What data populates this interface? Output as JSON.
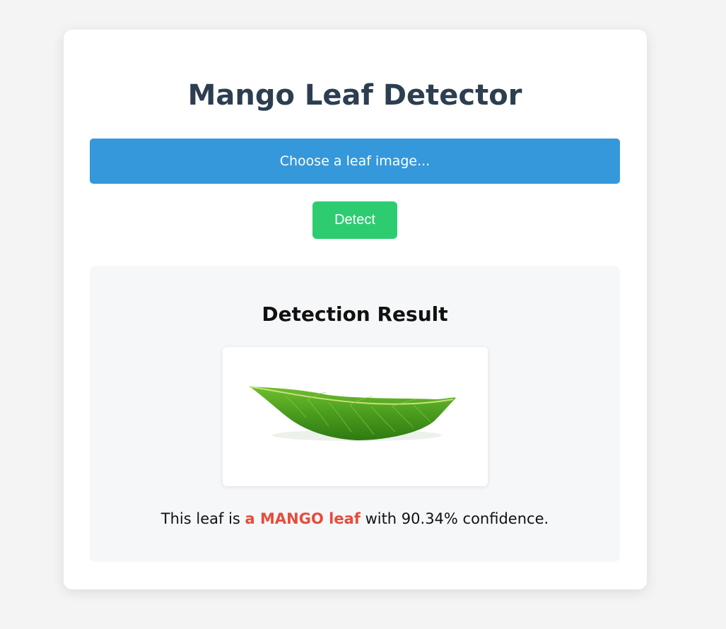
{
  "page": {
    "title": "Mango Leaf Detector"
  },
  "upload": {
    "label": "Choose a leaf image..."
  },
  "actions": {
    "detect_label": "Detect"
  },
  "result": {
    "heading": "Detection Result",
    "image_alt": "mango leaf",
    "text_prefix": "This leaf is ",
    "verdict": "a MANGO leaf",
    "text_suffix": " with 90.34% confidence."
  },
  "colors": {
    "background": "#f4f4f4",
    "title": "#2c3e50",
    "upload_button": "#3498db",
    "detect_button": "#2ecc71",
    "verdict": "#e74c3c",
    "result_panel": "#f6f7f9"
  },
  "icons": {
    "leaf_image": "mango-leaf-photo"
  }
}
